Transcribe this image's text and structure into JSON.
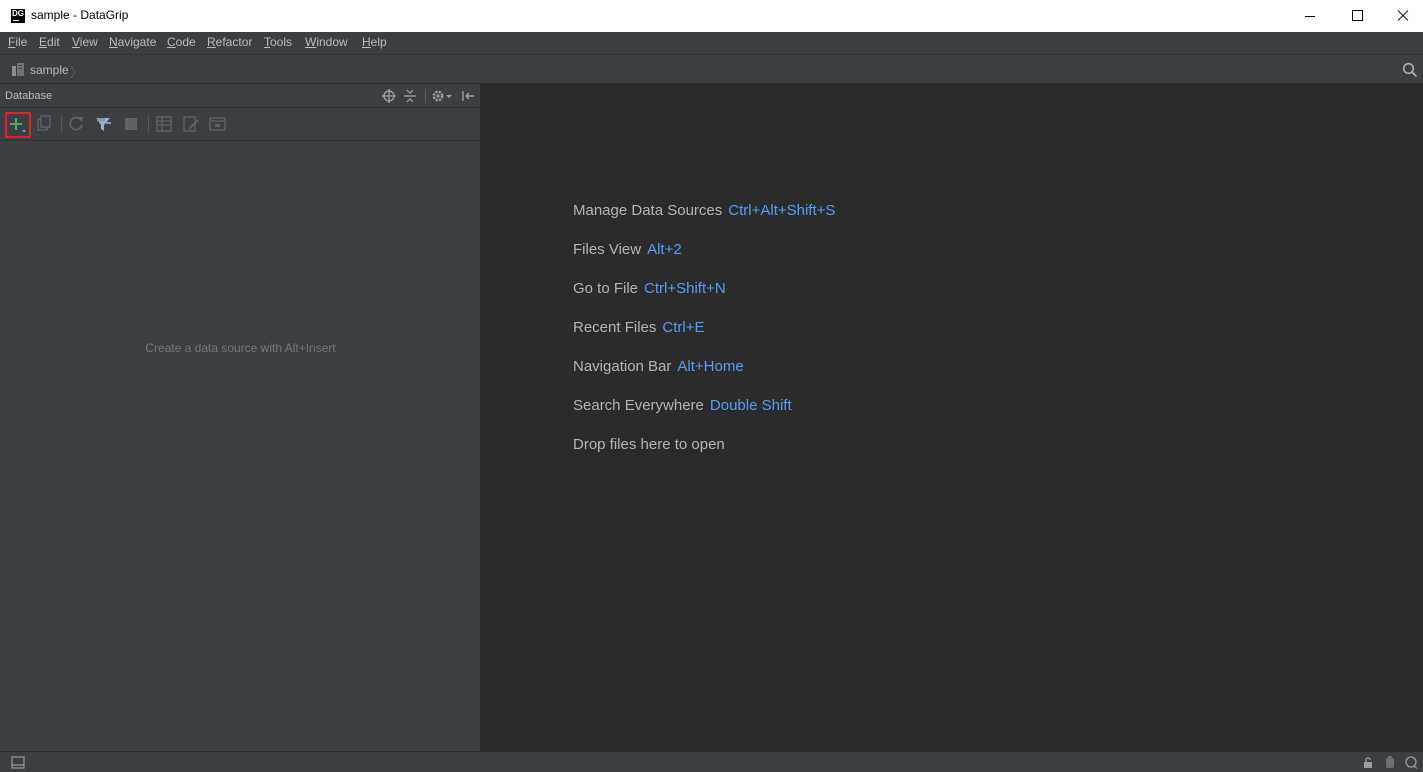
{
  "window": {
    "title": "sample - DataGrip",
    "app_icon": "DG"
  },
  "menu": [
    {
      "mnemonic": "F",
      "rest": "ile"
    },
    {
      "mnemonic": "E",
      "rest": "dit"
    },
    {
      "mnemonic": "V",
      "rest": "iew"
    },
    {
      "mnemonic": "N",
      "rest": "avigate"
    },
    {
      "mnemonic": "C",
      "rest": "ode"
    },
    {
      "mnemonic": "R",
      "rest": "efactor"
    },
    {
      "mnemonic": "T",
      "rest": "ools"
    },
    {
      "mnemonic": "W",
      "rest": "indow"
    },
    {
      "mnemonic": "H",
      "rest": "elp"
    }
  ],
  "navbar": {
    "project": "sample",
    "separator": "〉"
  },
  "database_panel": {
    "title": "Database",
    "empty_hint": "Create a data source with Alt+Insert",
    "header_icons": [
      "target-icon",
      "collapse-icon",
      "gear-icon",
      "hide-icon"
    ],
    "toolbar_icons": [
      "add-icon",
      "copy-icon",
      "refresh-icon",
      "schema-icon",
      "stop-icon",
      "table-icon",
      "edit-icon",
      "console-icon"
    ]
  },
  "editor": {
    "tips": [
      {
        "label": "Manage Data Sources",
        "key": "Ctrl+Alt+Shift+S"
      },
      {
        "label": "Files View",
        "key": "Alt+2"
      },
      {
        "label": "Go to File",
        "key": "Ctrl+Shift+N"
      },
      {
        "label": "Recent Files",
        "key": "Ctrl+E"
      },
      {
        "label": "Navigation Bar",
        "key": "Alt+Home"
      },
      {
        "label": "Search Everywhere",
        "key": "Double Shift"
      },
      {
        "label": "Drop files here to open",
        "key": ""
      }
    ]
  },
  "colors": {
    "shortcut": "#589df6",
    "highlight_box": "#e0202a",
    "add_plus": "#59a869"
  }
}
